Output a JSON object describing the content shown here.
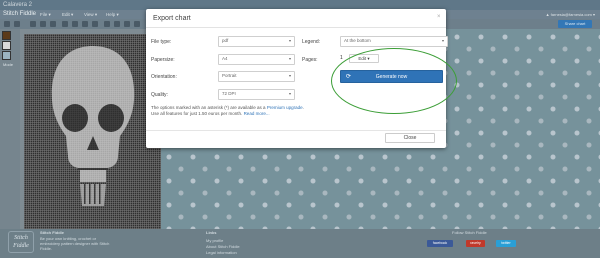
{
  "window": {
    "title": "Calavera 2"
  },
  "menubar": {
    "brand": "Stitch Fiddle",
    "menus": [
      "File ▾",
      "Edit ▾",
      "View ▾",
      "Help ▾"
    ],
    "user": "▲ farnesia@farnesia.com ▾"
  },
  "toolbar": {
    "share_label": "Share chart"
  },
  "left_panel": {
    "mode_label": "Mode"
  },
  "dialog": {
    "title": "Export chart",
    "close_symbol": "×",
    "fields": {
      "file_type": {
        "label": "File type:",
        "value": "pdf"
      },
      "papersize": {
        "label": "Papersize:",
        "value": "A4"
      },
      "orientation": {
        "label": "Orientation:",
        "value": "Portrait"
      },
      "quality": {
        "label": "Quality:",
        "value": "72 DPI"
      },
      "legend": {
        "label": "Legend:",
        "value": "At the bottom"
      },
      "pages": {
        "label": "Pages:",
        "value": "1",
        "edit_label": "Edit"
      }
    },
    "generate_label": "Generate now",
    "info_line1_a": "The options marked with an asterisk (*) are available as a",
    "info_line1_link": "Premium upgrade",
    "info_line1_b": ".",
    "info_line2_a": "Use all features for just 1.50 euros per month.",
    "info_line2_link": "Read more...",
    "close_button": "Close"
  },
  "footer": {
    "logo_line1": "Stitch",
    "logo_line2": "Fiddle",
    "about_title": "Stitch Fiddle",
    "about_text": "Be your own knitting, crochet or embroidery pattern designer with Stitch Fiddle.",
    "links_title": "Links",
    "links": [
      "My profile",
      "About Stitch Fiddle",
      "Legal information"
    ],
    "follow_title": "Follow Stitch Fiddle",
    "social": [
      "facebook",
      "ravelry",
      "twitter"
    ]
  },
  "colors": {
    "primary_button": "#2f73b7",
    "highlight_circle": "#3c9e37",
    "app_background": "#7f8c93"
  }
}
